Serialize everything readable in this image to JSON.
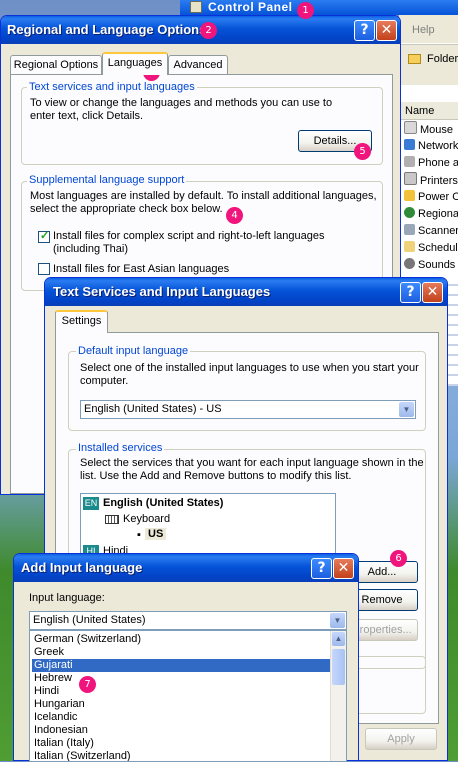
{
  "control_panel": {
    "title": "Control Panel",
    "menu_help": "Help",
    "folders_label": "Folder",
    "column_name": "Name",
    "items": [
      "Mouse",
      "Network",
      "Phone a",
      "Printers",
      "Power O",
      "Regiona",
      "Scanner",
      "Schedule",
      "Sounds a"
    ]
  },
  "regional": {
    "title": "Regional and Language Options",
    "tabs": [
      "Regional Options",
      "Languages",
      "Advanced"
    ],
    "text_services_group": "Text services and input languages",
    "text_services_desc": "To view or change the languages and methods you can use to enter text, click Details.",
    "details_button": "Details...",
    "supplemental_group": "Supplemental language support",
    "supplemental_desc": "Most languages are installed by default. To install additional languages, select the appropriate check box below.",
    "complex_script_label": "Install files for complex script and right-to-left languages (including Thai)",
    "complex_script_checked": true,
    "east_asian_label": "Install files for East Asian languages",
    "east_asian_checked": false
  },
  "text_services": {
    "title": "Text Services and Input Languages",
    "tab_settings": "Settings",
    "default_group": "Default input language",
    "default_desc": "Select one of the installed input languages to use when you start your computer.",
    "default_value": "English (United States) - US",
    "installed_group": "Installed services",
    "installed_desc": "Select the services that you want for each input language shown in the list. Use the Add and Remove buttons to modify this list.",
    "lang_code_en": "EN",
    "lang_english": "English (United States)",
    "keyboard_label": "Keyboard",
    "keyboard_us": "US",
    "lang_code_hi": "HI",
    "lang_hindi": "Hindi",
    "add_button": "Add...",
    "remove_button": "Remove",
    "properties_button": "Properties...",
    "apply_button": "Apply"
  },
  "add_input": {
    "title": "Add Input language",
    "input_language_label": "Input language:",
    "selected_value": "English (United States)",
    "options": [
      "German (Switzerland)",
      "Greek",
      "Gujarati",
      "Hebrew",
      "Hindi",
      "Hungarian",
      "Icelandic",
      "Indonesian",
      "Italian (Italy)",
      "Italian (Switzerland)"
    ],
    "highlighted_option": "Gujarati"
  },
  "markers": [
    "1",
    "2",
    "3",
    "4",
    "5",
    "6",
    "7"
  ],
  "colors": {
    "marker": "#f0147d",
    "title_bar": "#0553d8",
    "selection": "#316ac5",
    "group_label": "#0046d5"
  }
}
